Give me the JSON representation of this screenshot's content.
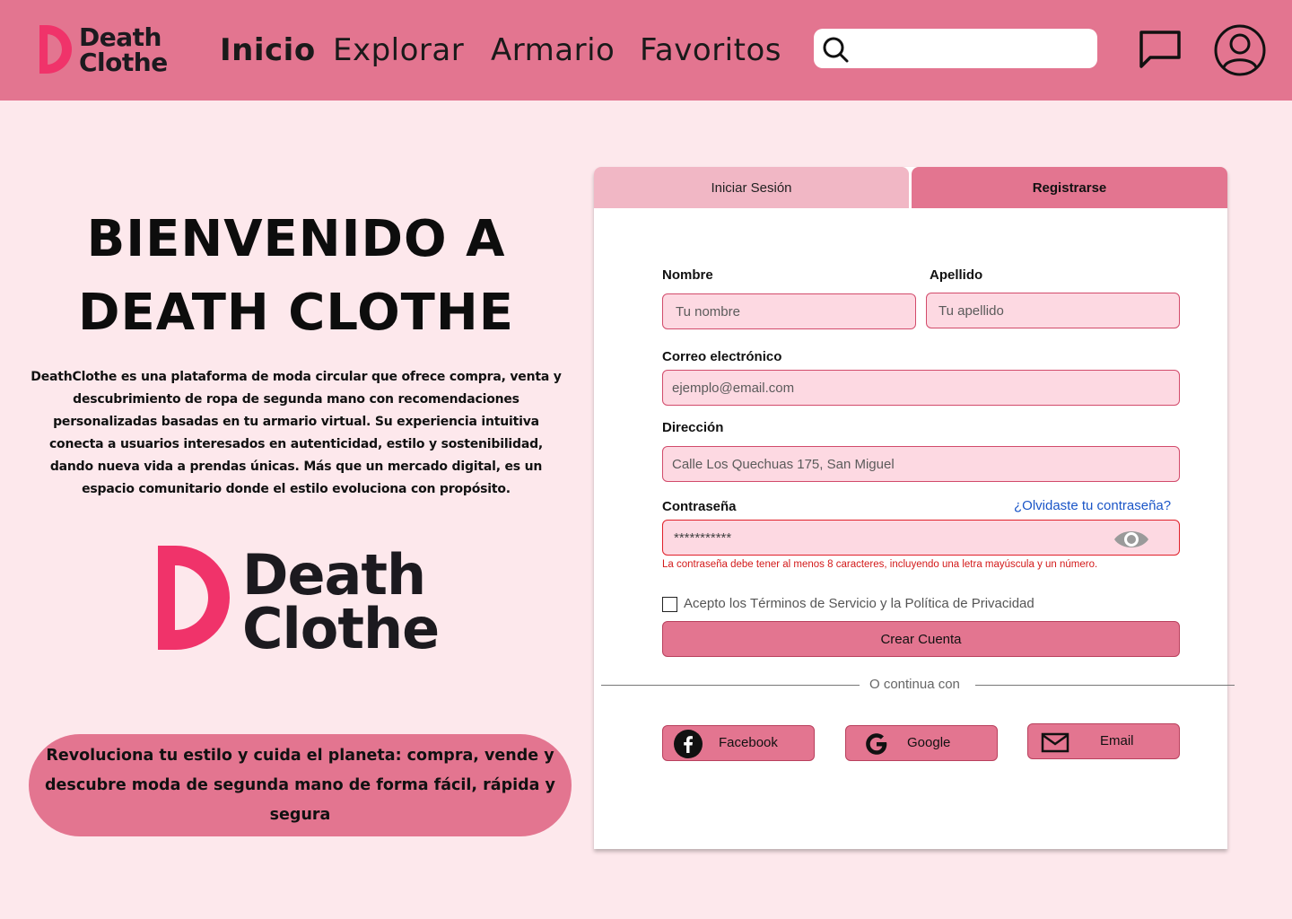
{
  "brand": {
    "line1": "Death",
    "line2": "Clothe"
  },
  "nav": {
    "inicio": "Inicio",
    "explorar": "Explorar",
    "armario": "Armario",
    "favoritos": "Favoritos"
  },
  "search": {
    "placeholder": ""
  },
  "hero": {
    "title": "BIENVENIDO A DEATH CLOTHE",
    "description": "DeathClothe es una plataforma de moda circular que ofrece compra, venta y descubrimiento de ropa de segunda mano con recomendaciones personalizadas basadas en tu armario virtual. Su experiencia intuitiva conecta a usuarios interesados en autenticidad, estilo y sostenibilidad, dando nueva vida a prendas únicas. Más que un mercado digital, es un espacio comunitario donde el estilo evoluciona con propósito.",
    "slogan": "Revoluciona tu estilo y cuida el planeta: compra, vende y descubre moda de segunda mano de forma fácil, rápida y segura"
  },
  "tabs": {
    "login": "Iniciar Sesión",
    "register": "Registrarse",
    "active": "register"
  },
  "form": {
    "nombre_label": "Nombre",
    "nombre_placeholder": "Tu nombre",
    "apellido_label": "Apellido",
    "apellido_placeholder": "Tu apellido",
    "email_label": "Correo electrónico",
    "email_placeholder": "ejemplo@email.com",
    "direccion_label": "Dirección",
    "direccion_placeholder": "Calle Los Quechuas 175, San Miguel",
    "password_label": "Contraseña",
    "password_value": "***********",
    "forgot": "¿Olvidaste tu contraseña?",
    "password_error": "La contraseña debe tener al menos 8 caracteres, incluyendo una letra mayúscula y un número.",
    "terms": "Acepto los Términos de Servicio y la Política de Privacidad",
    "terms_checked": false,
    "submit": "Crear Cuenta",
    "divider": "O continua con",
    "facebook": "Facebook",
    "google": "Google",
    "email": "Email"
  },
  "colors": {
    "header": "#e37590",
    "background": "#fde8ec",
    "brand_red": "#f0336a",
    "field_bg": "#fdd9e2",
    "error": "#d31a1a",
    "link": "#1a55c7"
  }
}
